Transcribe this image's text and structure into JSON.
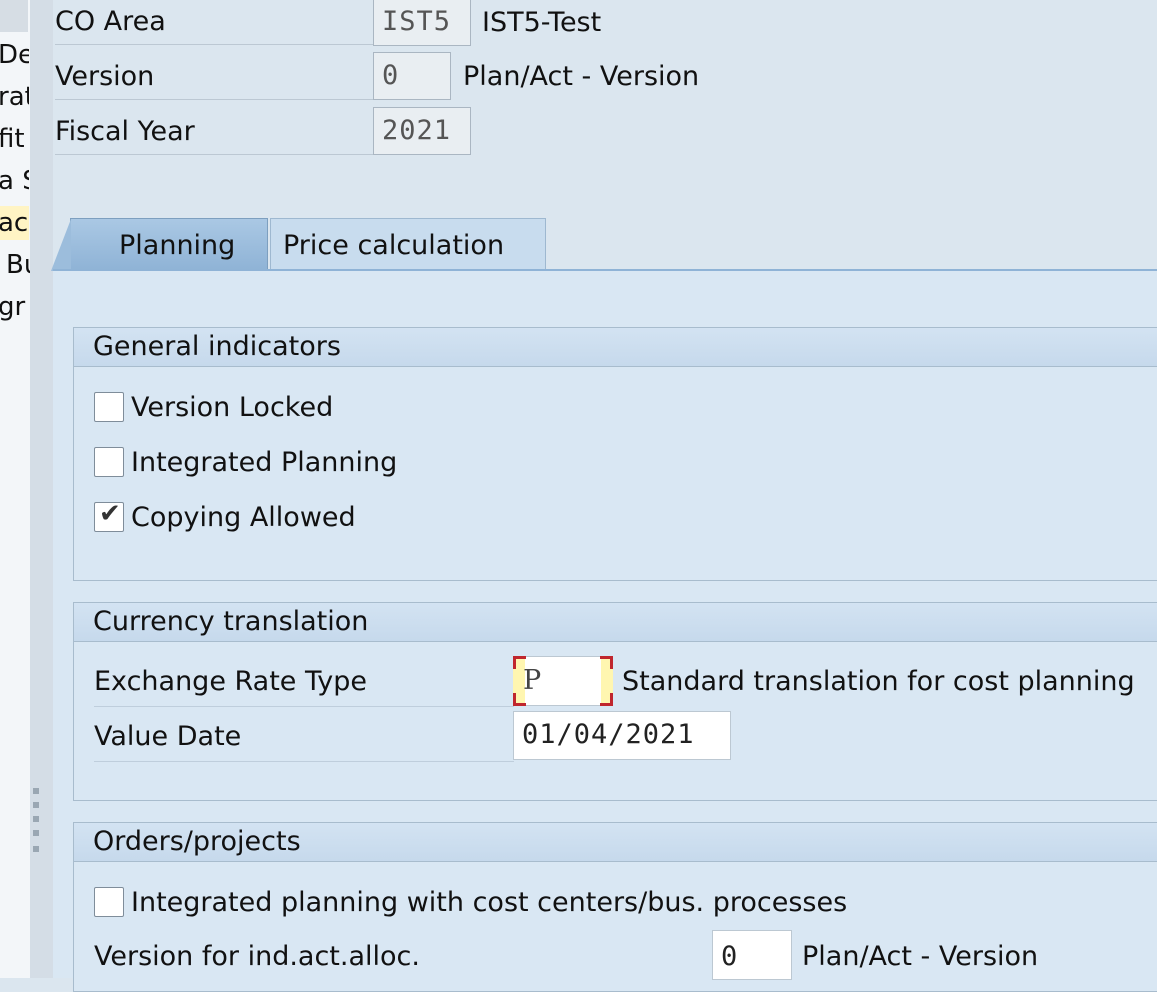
{
  "nav": {
    "fragments": [
      "De",
      "rat",
      "fit",
      "a S",
      "ach",
      "Bu",
      "gr"
    ]
  },
  "header": {
    "co_area_label": "CO Area",
    "co_area_value": "IST5",
    "co_area_desc": "IST5-Test",
    "version_label": "Version",
    "version_value": "0",
    "version_desc": "Plan/Act - Version",
    "fiscal_year_label": "Fiscal Year",
    "fiscal_year_value": "2021"
  },
  "tabs": [
    {
      "label": "Planning",
      "active": true
    },
    {
      "label": "Price calculation",
      "active": false
    }
  ],
  "general_indicators": {
    "title": "General indicators",
    "version_locked": {
      "label": "Version Locked",
      "checked": false
    },
    "integrated_planning": {
      "label": "Integrated Planning",
      "checked": false
    },
    "copying_allowed": {
      "label": "Copying Allowed",
      "checked": true
    }
  },
  "currency_translation": {
    "title": "Currency translation",
    "exchange_rate_type_label": "Exchange Rate Type",
    "exchange_rate_type_value": "P",
    "exchange_rate_type_desc": "Standard translation for cost planning",
    "value_date_label": "Value Date",
    "value_date_value": "01/04/2021"
  },
  "orders_projects": {
    "title": "Orders/projects",
    "integrated_planning_cc": {
      "label": "Integrated planning with cost centers/bus. processes",
      "checked": false
    },
    "ind_act_alloc_label": "Version for ind.act.alloc.",
    "ind_act_alloc_value": "0",
    "ind_act_alloc_desc": "Plan/Act - Version"
  },
  "colors": {
    "tab_active": "#8fb3d6",
    "panel_bg": "#d9e7f3",
    "required_marker": "#c0262d"
  }
}
